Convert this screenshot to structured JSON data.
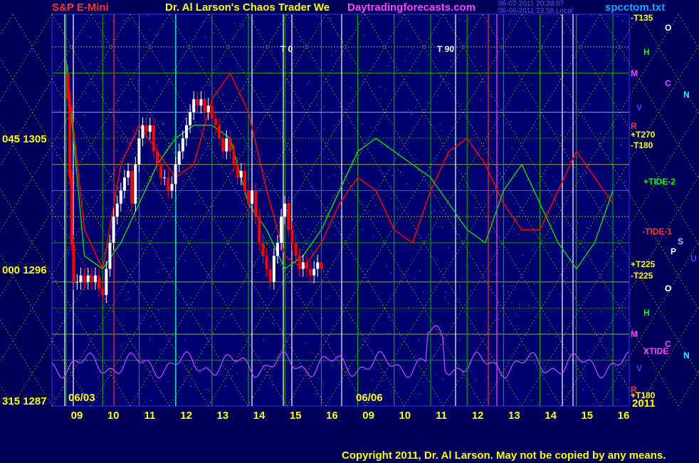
{
  "header": {
    "left_title": "S&P E-Mini",
    "main_title": "Dr. Al Larson's Chaos Trader We",
    "site": "Daytradingforecasts.com",
    "timestamp1": "06-07-2011 20:28:07",
    "timestamp2": "06-06-2011 23:58 Local",
    "filename": "spcctom.txt"
  },
  "copyright": "Copyright 2011, Dr. Al Larson. May not be copied by any means.",
  "colors": {
    "background": "#00005a",
    "plot_background": "#00006e",
    "title_red": "#ff3030",
    "title_yellow": "#ffff00",
    "site_magenta": "#ff40ff",
    "grid_green": "#00c000",
    "grid_yellow": "#d0d000",
    "tide_green": "#10d010",
    "price_red": "#ff0000",
    "price_white": "#ffffff",
    "xtide_magenta": "#c040ff"
  },
  "chart_data": {
    "type": "line",
    "title": "S&P E-Mini",
    "y_labels": [
      {
        "text": "045  1305",
        "value": 1305
      },
      {
        "text": "000  1296",
        "value": 1296
      },
      {
        "text": "315  1287",
        "value": 1287
      }
    ],
    "ylim": [
      1285.5,
      1315.5
    ],
    "date_labels": [
      "06/03",
      "06/06"
    ],
    "hour_ticks": [
      "09",
      "10",
      "11",
      "12",
      "13",
      "14",
      "15",
      "16",
      "09",
      "10",
      "11",
      "12",
      "13",
      "14",
      "15",
      "16"
    ],
    "session_days": [
      "06/03",
      "06/06"
    ],
    "year_label": "2011",
    "cycle_markers": [
      "T  0",
      "T  90"
    ],
    "right_labels": [
      {
        "text": "-T135",
        "color": "#ffff00"
      },
      {
        "text": "+T270",
        "color": "#ffff00"
      },
      {
        "text": "-T180",
        "color": "#ffff00"
      },
      {
        "text": "+TIDE-2",
        "color": "#00ff00"
      },
      {
        "text": "-TIDE-1",
        "color": "#ff3030"
      },
      {
        "text": "+T225",
        "color": "#ffff00"
      },
      {
        "text": "-T225",
        "color": "#ffff00"
      },
      {
        "text": "XTIDE",
        "color": "#ff40ff"
      },
      {
        "text": "+T180",
        "color": "#ffff00"
      }
    ],
    "planet_column": [
      {
        "text": "O",
        "color": "#ffffff"
      },
      {
        "text": "H",
        "color": "#00ff00"
      },
      {
        "text": "M",
        "color": "#ff40ff"
      },
      {
        "text": "C",
        "color": "#ff40ff"
      },
      {
        "text": "N",
        "color": "#00ffff"
      },
      {
        "text": "V",
        "color": "#4040ff"
      },
      {
        "text": "R",
        "color": "#ff3030"
      },
      {
        "text": "O",
        "color": "#ffffff"
      },
      {
        "text": "S",
        "color": "#c0c0ff"
      },
      {
        "text": "P",
        "color": "#ffffff"
      },
      {
        "text": "U",
        "color": "#4040ff"
      },
      {
        "text": "O",
        "color": "#ffffff"
      },
      {
        "text": "H",
        "color": "#00ff00"
      },
      {
        "text": "M",
        "color": "#ff40ff"
      },
      {
        "text": "C",
        "color": "#ff40ff"
      },
      {
        "text": "N",
        "color": "#00ffff"
      },
      {
        "text": "V",
        "color": "#4040ff"
      },
      {
        "text": "R",
        "color": "#ff3030"
      }
    ],
    "series": [
      {
        "type": "candlestick",
        "x": [
          0,
          0.05,
          0.1,
          0.15,
          0.2,
          0.3,
          0.4,
          0.5,
          0.6,
          0.7,
          0.8,
          0.9,
          1.0,
          1.1,
          1.2,
          1.3,
          1.4,
          1.5,
          1.6,
          1.7,
          1.8,
          1.9,
          2.0,
          2.1,
          2.2,
          2.3,
          2.4,
          2.5,
          2.6,
          2.7,
          2.8,
          2.9,
          3.0,
          3.1,
          3.2,
          3.3,
          3.4,
          3.5,
          3.6,
          3.7,
          3.8,
          3.9,
          4.0,
          4.1,
          4.2,
          4.3,
          4.4,
          4.5,
          4.6,
          4.7,
          4.8,
          4.9,
          5.0,
          5.1,
          5.2,
          5.3,
          5.4,
          5.5,
          5.6,
          5.7,
          5.8,
          5.9,
          6.0,
          6.1,
          6.2,
          6.3,
          6.4,
          6.5,
          6.6,
          6.7,
          6.8,
          6.9,
          7.0
        ],
        "close": [
          1311,
          1309,
          1303,
          1298,
          1295,
          1295,
          1295.5,
          1295,
          1295.5,
          1295,
          1295.5,
          1294.5,
          1294,
          1296,
          1298,
          1300,
          1301,
          1302,
          1303,
          1303.5,
          1301,
          1304,
          1306,
          1307,
          1306.5,
          1307,
          1305,
          1304,
          1303,
          1303,
          1302,
          1302.5,
          1304,
          1305,
          1306,
          1307,
          1308,
          1309,
          1308.5,
          1309,
          1308,
          1308.5,
          1307.5,
          1307,
          1306,
          1305,
          1306,
          1305,
          1304,
          1303,
          1303.5,
          1302,
          1301,
          1302,
          1300,
          1298,
          1297,
          1296,
          1295,
          1297,
          1298,
          1300,
          1301,
          1299,
          1298,
          1297,
          1296,
          1296.5,
          1296,
          1295.5,
          1296,
          1296.5,
          1296
        ]
      },
      {
        "name": "-TIDE-1",
        "x": [
          0,
          0.5,
          1,
          1.5,
          2,
          2.5,
          3,
          3.5,
          4,
          4.5,
          5,
          5.5,
          6,
          6.5,
          7,
          7.5,
          8,
          8.5,
          9,
          9.5,
          10,
          10.5,
          11,
          11.5,
          12,
          12.5,
          13,
          13.5,
          14,
          14.5,
          15
        ],
        "y": [
          1312,
          1299,
          1296,
          1304,
          1307,
          1305,
          1303,
          1304,
          1309,
          1311,
          1308,
          1302,
          1297,
          1296,
          1298,
          1301,
          1303,
          1302,
          1299,
          1298,
          1302,
          1305,
          1306,
          1304,
          1301,
          1299,
          1299,
          1302,
          1305,
          1303,
          1301
        ]
      },
      {
        "name": "+TIDE-2",
        "x": [
          0,
          0.5,
          1,
          1.5,
          2,
          2.5,
          3,
          3.5,
          4,
          4.5,
          5,
          5.5,
          6,
          6.5,
          7,
          7.5,
          8,
          8.5,
          9,
          9.5,
          10,
          10.5,
          11,
          11.5,
          12,
          12.5,
          13,
          13.5,
          14,
          14.5,
          15
        ],
        "y": [
          1312,
          1297,
          1296,
          1298,
          1301,
          1304,
          1306,
          1307,
          1307,
          1306,
          1301,
          1299,
          1296,
          1297,
          1299,
          1302,
          1305,
          1306,
          1305,
          1304,
          1303,
          1301,
          1299,
          1298,
          1302,
          1304,
          1301,
          1298,
          1296,
          1298,
          1302
        ]
      }
    ]
  }
}
